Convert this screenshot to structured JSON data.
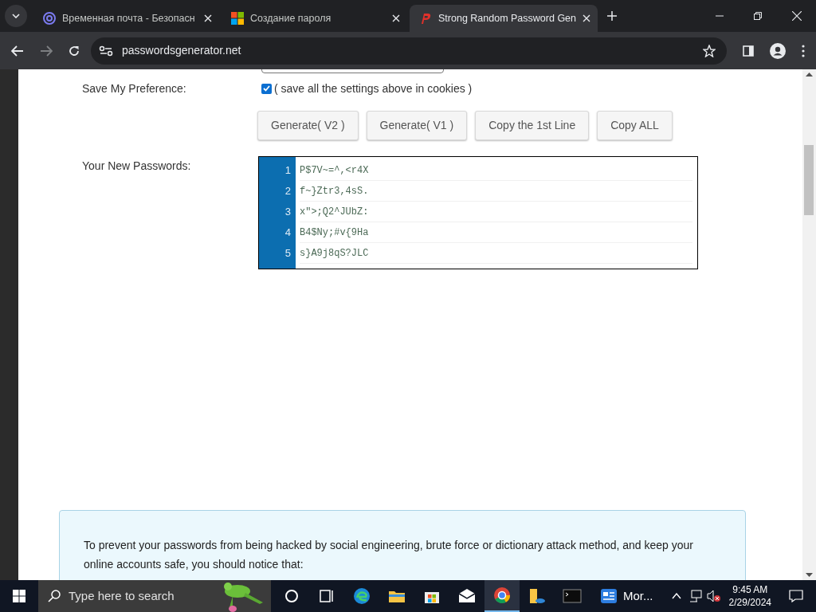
{
  "browser": {
    "tabs": [
      {
        "title": "Временная почта - Безопасн",
        "selected": false,
        "kind": "at"
      },
      {
        "title": "Создание пароля",
        "selected": false,
        "kind": "windows"
      },
      {
        "title": "Strong Random Password Gen",
        "selected": true,
        "kind": "p"
      }
    ],
    "address": "passwordsgenerator.net"
  },
  "form": {
    "preference": {
      "label": "Save My Preference:",
      "checked": true,
      "text": "( save all the settings above in cookies )"
    },
    "buttons": [
      "Generate( V2 )",
      "Generate( V1 )",
      "Copy the 1st Line",
      "Copy ALL"
    ],
    "passwords_label": "Your New Passwords:",
    "passwords": [
      {
        "number": "1",
        "text": "P$7V~=^,<r4X"
      },
      {
        "number": "2",
        "text": "f~}Ztr3,4sS."
      },
      {
        "number": "3",
        "text": "x\">;Q2^JUbZ:"
      },
      {
        "number": "4",
        "text": "B4$Ny;#v{9Ha"
      },
      {
        "number": "5",
        "text": "s}A9j8qS?JLC"
      }
    ]
  },
  "notice": {
    "intro": "To prevent your passwords from being hacked by social engineering, brute force or dictionary attack method, and keep your online accounts safe, you should notice that:"
  },
  "taskbar": {
    "search_placeholder": "Type here to search",
    "app_label": "Mor...",
    "time": "9:45 AM",
    "date": "2/29/2024"
  }
}
